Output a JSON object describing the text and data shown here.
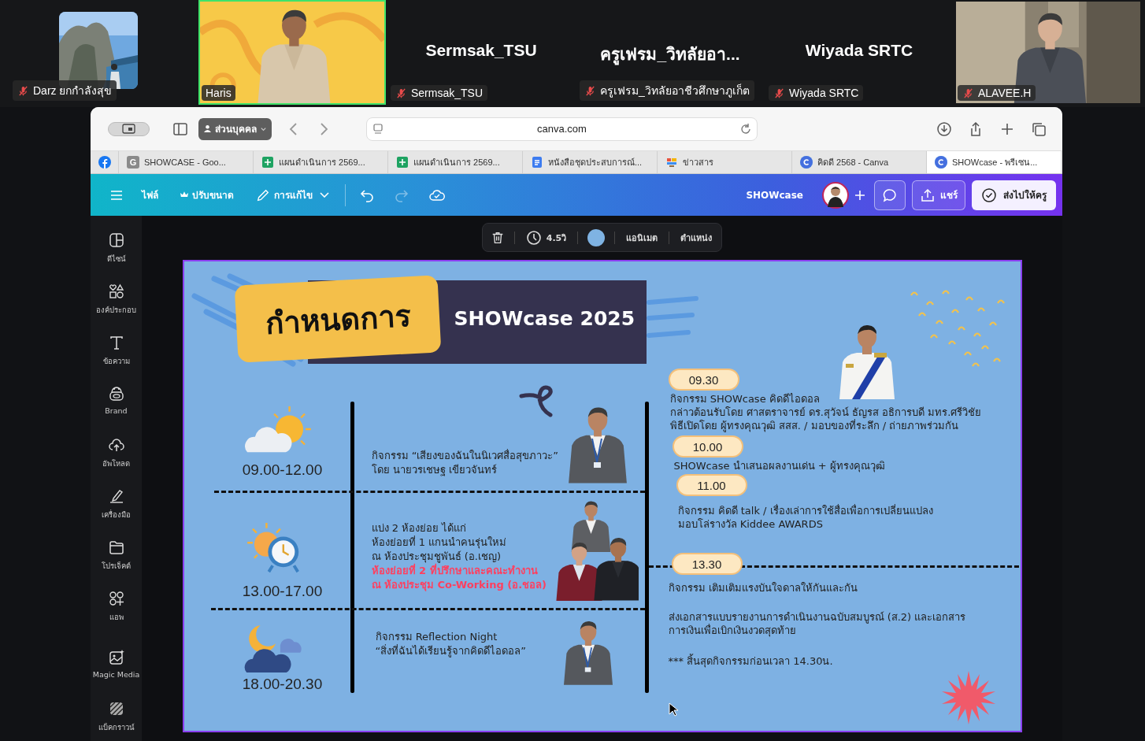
{
  "participants": [
    {
      "name": "Darz ยกกำลังสุข",
      "muted": true,
      "active": false
    },
    {
      "name": "Haris",
      "kind": "video",
      "muted": false,
      "active": true
    },
    {
      "name": "Sermsak_TSU",
      "heading": "Sermsak_TSU",
      "kind": "name",
      "muted": true,
      "active": false
    },
    {
      "name": "ครูเฟรม_วิทลัยอาชีวศึกษาภูเก็ต",
      "heading": "ครูเฟรม_วิทลัยอา...",
      "kind": "name",
      "muted": true,
      "active": false
    },
    {
      "name": "Wiyada SRTC",
      "heading": "Wiyada SRTC",
      "kind": "name",
      "muted": true,
      "active": false
    },
    {
      "name": "ALAVEE.H",
      "kind": "video",
      "muted": true,
      "active": false
    }
  ],
  "browser": {
    "profile": "ส่วนบุคคล",
    "url": "canva.com",
    "tabs": [
      {
        "kind": "facebook",
        "selected": false
      },
      {
        "kind": "google",
        "favicon_text": "G",
        "title": "SHOWCASE - Goo...",
        "selected": false
      },
      {
        "kind": "sheets",
        "title": "แผนดำเนินการ 2569...",
        "selected": false
      },
      {
        "kind": "sheets",
        "title": "แผนดำเนินการ 2569...",
        "selected": false
      },
      {
        "kind": "docs",
        "title": "หนังสือชุดประสบการณ์...",
        "selected": false
      },
      {
        "kind": "news",
        "title": "ข่าวสาร",
        "selected": false
      },
      {
        "kind": "canva",
        "title": "คิดดี 2568 - Canva",
        "selected": false
      },
      {
        "kind": "canva",
        "title": "SHOWcase - พรีเซน...",
        "selected": true
      }
    ]
  },
  "canva_toolbar": {
    "file": "ไฟล์",
    "resize": "ปรับขนาด",
    "edit": "การแก้ไข",
    "undo_disabled": false,
    "redo_disabled": true,
    "title": "SHOWcase",
    "share": "แชร์",
    "submit": "ส่งไปให้ครู"
  },
  "sidebar": {
    "items": [
      {
        "label": "ดีไซน์",
        "kind": "design"
      },
      {
        "label": "องค์ประกอบ",
        "kind": "elements"
      },
      {
        "label": "ข้อความ",
        "kind": "text"
      },
      {
        "label": "Brand",
        "kind": "brand"
      },
      {
        "label": "อัพโหลด",
        "kind": "upload"
      },
      {
        "label": "เครื่องมือ",
        "kind": "draw"
      },
      {
        "label": "โปรเจ็คต์",
        "kind": "folder"
      },
      {
        "label": "แอพ",
        "kind": "apps"
      }
    ],
    "extra_items": [
      {
        "label": "Magic Media",
        "kind": "magic"
      },
      {
        "label": "แบ็คกราวน์",
        "kind": "background"
      }
    ]
  },
  "element_toolbar": {
    "duration": "4.5วิ",
    "color": "#7fb3e3",
    "animate": "แอนิเมต",
    "position": "ตำแหน่ง"
  },
  "slide": {
    "title": "กำหนดการ",
    "subtitle": "SHOWcase 2025",
    "left_rows": [
      {
        "time": "09.00-12.00",
        "kind": "morning",
        "paragraphs": [
          {
            "highlight": false,
            "lines": [
              "กิจกรรม “เสียงของฉันในนิเวศสื่อสุขภาวะ”",
              "โดย นายวรเชษฐ เขียวจันทร์"
            ]
          }
        ]
      },
      {
        "time": "13.00-17.00",
        "kind": "afternoon",
        "paragraphs": [
          {
            "highlight": false,
            "lines": [
              "แบ่ง 2 ห้องย่อย ได้แก่",
              "ห้องย่อยที่ 1 แกนนำคนรุ่นใหม่",
              "ณ ห้องประชุมชูพันธ์ (อ.เชญ)"
            ]
          },
          {
            "highlight": true,
            "lines": [
              "ห้องย่อยที่ 2 ที่ปรึกษาและคณะทำงาน",
              "ณ ห้องประชุม Co-Working (อ.ชอล)"
            ]
          }
        ]
      },
      {
        "time": "18.00-20.30",
        "kind": "evening",
        "paragraphs": [
          {
            "highlight": false,
            "lines": [
              "กิจกรรม Reflection Night",
              "“สิ่งที่ฉันได้เรียนรู้จากคิดดีไอดอล”"
            ]
          }
        ]
      }
    ],
    "right_items": [
      {
        "time": "09.30",
        "paragraphs": [
          [
            "กิจกรรม SHOWcase คิดดีไอดอล",
            "กล่าวต้อนรับโดย ศาสตราจารย์ ดร.สุวัจน์ ธัญรส อธิการบดี มทร.ศรีวิชัย",
            "พิธีเปิดโดย ผู้ทรงคุณวุฒิ สสส. / มอบของที่ระลึก / ถ่ายภาพร่วมกัน"
          ]
        ]
      },
      {
        "time": "10.00",
        "paragraphs": [
          [
            "SHOWcase นำเสนอผลงานเด่น + ผู้ทรงคุณวุฒิ"
          ]
        ]
      },
      {
        "time": "11.00",
        "paragraphs": [
          [
            "กิจกรรม คิดดี talk / เรื่องเล่าการใช้สื่อเพื่อการเปลี่ยนแปลง",
            "มอบโล่รางวัล Kiddee AWARDS"
          ]
        ]
      },
      {
        "time": "13.30",
        "paragraphs": [
          [
            "กิจกรรม เติมเติมแรงบันใจดาลให้กันและกัน"
          ],
          [
            "ส่งเอกสารแบบรายงานการดำเนินงานฉบับสมบูรณ์ (ส.2) และเอกสาร",
            "การเงินเพื่อเบิกเงินงวดสุดท้าย"
          ],
          [
            "*** สิ้นสุดกิจกรรมก่อนเวลา 14.30น."
          ]
        ]
      }
    ]
  }
}
